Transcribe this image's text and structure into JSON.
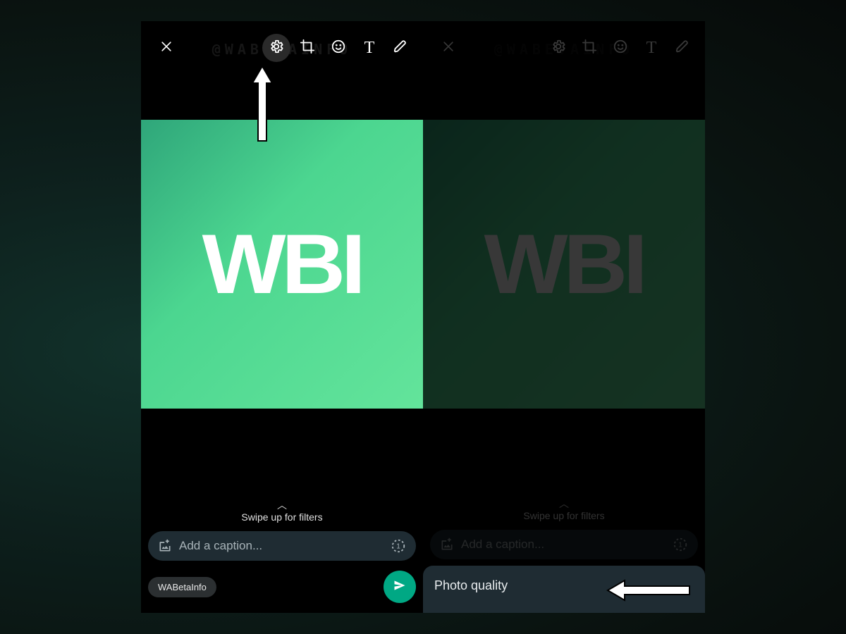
{
  "watermark": "@WABETAINFO",
  "image_text": "WBI",
  "left": {
    "toolbar": {
      "close": "close",
      "gear": "settings",
      "crop": "crop",
      "emoji": "emoji",
      "text": "T",
      "draw": "draw"
    },
    "swipe_label": "Swipe up for filters",
    "caption_placeholder": "Add a caption...",
    "recipient": "WABetaInfo"
  },
  "right": {
    "toolbar": {
      "close": "close",
      "gear": "settings",
      "crop": "crop",
      "emoji": "emoji",
      "text": "T",
      "draw": "draw"
    },
    "swipe_label": "Swipe up for filters",
    "caption_placeholder": "Add a caption...",
    "sheet_title": "Photo quality"
  }
}
